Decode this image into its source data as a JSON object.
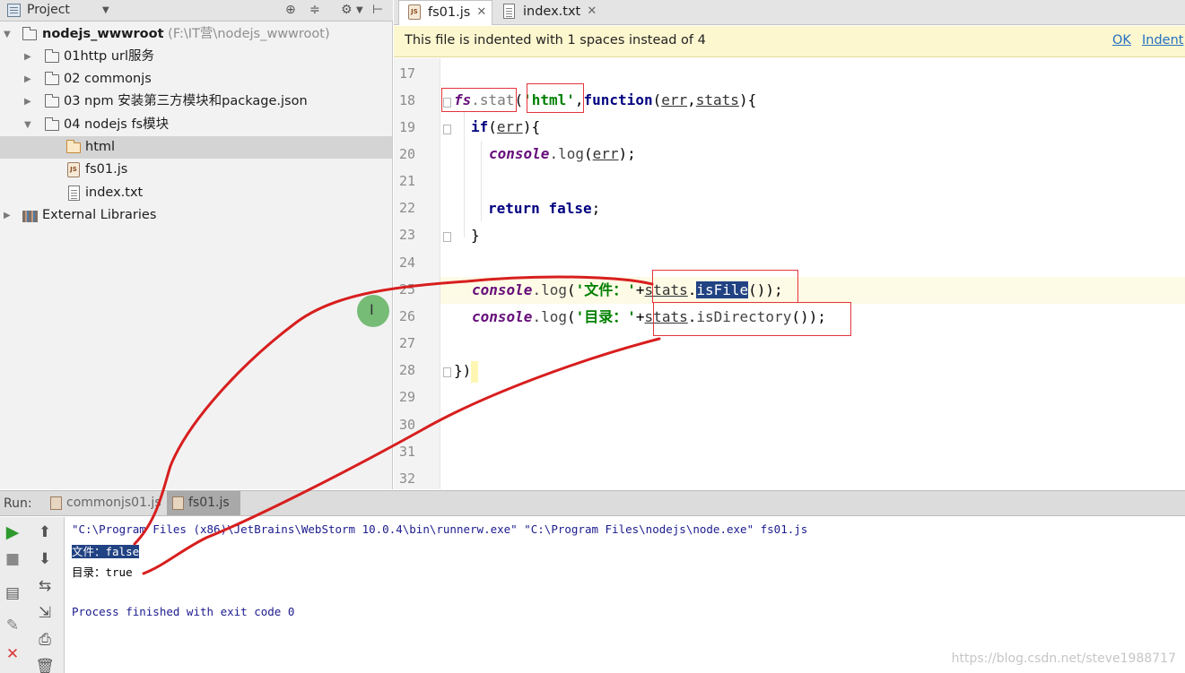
{
  "project_panel": {
    "title": "Project",
    "tree": [
      {
        "label": "nodejs_wwwroot",
        "path": "(F:\\IT营\\nodejs_wwwroot)",
        "type": "root"
      },
      {
        "label": "01http url服务",
        "type": "folder"
      },
      {
        "label": "02 commonjs",
        "type": "folder"
      },
      {
        "label": "03 npm 安装第三方模块和package.json",
        "type": "folder"
      },
      {
        "label": "04 nodejs fs模块",
        "type": "folder-open"
      },
      {
        "label": "html",
        "type": "folder-orange",
        "selected": true
      },
      {
        "label": "fs01.js",
        "type": "js-file"
      },
      {
        "label": "index.txt",
        "type": "txt-file"
      },
      {
        "label": "External Libraries",
        "type": "libraries"
      }
    ]
  },
  "editor": {
    "tabs": [
      {
        "label": "fs01.js",
        "active": true
      },
      {
        "label": "index.txt",
        "active": false
      }
    ],
    "notification": {
      "message": "This file is indented with 1 spaces instead of 4",
      "ok_link": "OK",
      "indent_link": "Indent"
    },
    "line_numbers": [
      "17",
      "18",
      "19",
      "20",
      "21",
      "22",
      "23",
      "24",
      "25",
      "26",
      "27",
      "28",
      "29",
      "30",
      "31",
      "32"
    ],
    "code": {
      "l18": {
        "obj": "fs",
        "method": "stat",
        "arg": "'html'",
        "kw": "function",
        "p1": "err",
        "p2": "stats"
      },
      "l19": {
        "kw": "if",
        "param": "err"
      },
      "l20": {
        "obj": "console",
        "method": "log",
        "param": "err"
      },
      "l22": {
        "kw1": "return",
        "kw2": "false"
      },
      "l25": {
        "obj": "console",
        "method": "log",
        "str": "'文件：'",
        "var": "stats",
        "call": "isFile",
        "tail": "());"
      },
      "l26": {
        "obj": "console",
        "method": "log",
        "str": "'目录：'",
        "var": "stats",
        "call": "isDirectory",
        "tail": "());"
      },
      "l28": {
        "text": "})"
      }
    }
  },
  "run_panel": {
    "label": "Run:",
    "tabs": [
      {
        "label": "commonjs01.js",
        "active": false
      },
      {
        "label": "fs01.js",
        "active": true
      }
    ],
    "console_lines": {
      "command": "\"C:\\Program Files (x86)\\JetBrains\\WebStorm 10.0.4\\bin\\runnerw.exe\" \"C:\\Program Files\\nodejs\\node.exe\" fs01.js",
      "out1": "文件：false",
      "out2": "目录：true",
      "exit": "Process finished with exit code 0"
    },
    "watermark": "https://blog.csdn.net/steve1988717"
  },
  "colors": {
    "annotation_red": "#d81e1e",
    "selection_blue": "#214283",
    "cursor_green": "#4ca84c"
  }
}
